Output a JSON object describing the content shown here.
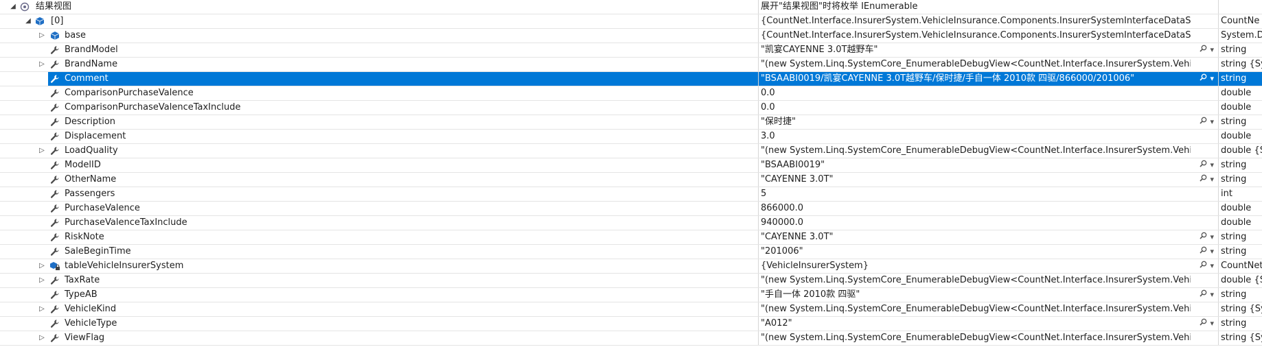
{
  "header": {
    "name": "结果视图",
    "value": "展开\"结果视图\"时将枚举 IEnumerable"
  },
  "root": {
    "name": "[0]",
    "value": "{CountNet.Interface.InsurerSystem.VehicleInsurance.Components.InsurerSystemInterfaceDataSet.Vehic",
    "type": "CountNe"
  },
  "rows": [
    {
      "name": "base",
      "value": "{CountNet.Interface.InsurerSystem.VehicleInsurance.Components.InsurerSystemInterfaceDataSet.Vehic",
      "type": "System.D",
      "expandable": true,
      "icon": "cube",
      "tools": false
    },
    {
      "name": "BrandModel",
      "value": "\"凯宴CAYENNE 3.0T越野车\"",
      "type": "string",
      "expandable": false,
      "icon": "wrench",
      "tools": true
    },
    {
      "name": "BrandName",
      "value": "\"(new System.Linq.SystemCore_EnumerableDebugView<CountNet.Interface.InsurerSystem.VehicleInsu",
      "type": "string {Sy",
      "expandable": true,
      "icon": "wrench",
      "tools": false
    },
    {
      "name": "Comment",
      "value": "\"BSAABI0019/凯宴CAYENNE 3.0T越野车/保时捷/手自一体 2010款 四驱/866000/201006\"",
      "type": "string",
      "expandable": false,
      "icon": "wrench",
      "tools": true,
      "selected": true
    },
    {
      "name": "ComparisonPurchaseValence",
      "value": "0.0",
      "type": "double",
      "expandable": false,
      "icon": "wrench",
      "tools": false
    },
    {
      "name": "ComparisonPurchaseValenceTaxInclude",
      "value": "0.0",
      "type": "double",
      "expandable": false,
      "icon": "wrench",
      "tools": false
    },
    {
      "name": "Description",
      "value": "\"保时捷\"",
      "type": "string",
      "expandable": false,
      "icon": "wrench",
      "tools": true
    },
    {
      "name": "Displacement",
      "value": "3.0",
      "type": "double",
      "expandable": false,
      "icon": "wrench",
      "tools": false
    },
    {
      "name": "LoadQuality",
      "value": "\"(new System.Linq.SystemCore_EnumerableDebugView<CountNet.Interface.InsurerSystem.VehicleInsu",
      "type": "double {S",
      "expandable": true,
      "icon": "wrench",
      "tools": false
    },
    {
      "name": "ModelID",
      "value": "\"BSAABI0019\"",
      "type": "string",
      "expandable": false,
      "icon": "wrench",
      "tools": true
    },
    {
      "name": "OtherName",
      "value": "\"CAYENNE 3.0T\"",
      "type": "string",
      "expandable": false,
      "icon": "wrench",
      "tools": true
    },
    {
      "name": "Passengers",
      "value": "5",
      "type": "int",
      "expandable": false,
      "icon": "wrench",
      "tools": false
    },
    {
      "name": "PurchaseValence",
      "value": "866000.0",
      "type": "double",
      "expandable": false,
      "icon": "wrench",
      "tools": false
    },
    {
      "name": "PurchaseValenceTaxInclude",
      "value": "940000.0",
      "type": "double",
      "expandable": false,
      "icon": "wrench",
      "tools": false
    },
    {
      "name": "RiskNote",
      "value": "\"CAYENNE 3.0T\"",
      "type": "string",
      "expandable": false,
      "icon": "wrench",
      "tools": true
    },
    {
      "name": "SaleBeginTime",
      "value": "\"201006\"",
      "type": "string",
      "expandable": false,
      "icon": "wrench",
      "tools": true
    },
    {
      "name": "tableVehicleInsurerSystem",
      "value": "{VehicleInsurerSystem}",
      "type": "CountNet",
      "expandable": true,
      "icon": "cube-lock",
      "tools": true
    },
    {
      "name": "TaxRate",
      "value": "\"(new System.Linq.SystemCore_EnumerableDebugView<CountNet.Interface.InsurerSystem.VehicleInsu",
      "type": "double {S",
      "expandable": true,
      "icon": "wrench",
      "tools": false
    },
    {
      "name": "TypeAB",
      "value": "\"手自一体 2010款 四驱\"",
      "type": "string",
      "expandable": false,
      "icon": "wrench",
      "tools": true
    },
    {
      "name": "VehicleKind",
      "value": "\"(new System.Linq.SystemCore_EnumerableDebugView<CountNet.Interface.InsurerSystem.VehicleInsu",
      "type": "string {Sy",
      "expandable": true,
      "icon": "wrench",
      "tools": false
    },
    {
      "name": "VehicleType",
      "value": "\"A012\"",
      "type": "string",
      "expandable": false,
      "icon": "wrench",
      "tools": true
    },
    {
      "name": "ViewFlag",
      "value": "\"(new System.Linq.SystemCore_EnumerableDebugView<CountNet.Interface.InsurerSystem.VehicleInsu",
      "type": "string {Sy",
      "expandable": true,
      "icon": "wrench",
      "tools": false
    }
  ],
  "colors": {
    "selection": "#0078d7",
    "cube": "#1f6fc5",
    "wrench": "#4a4a4a"
  }
}
